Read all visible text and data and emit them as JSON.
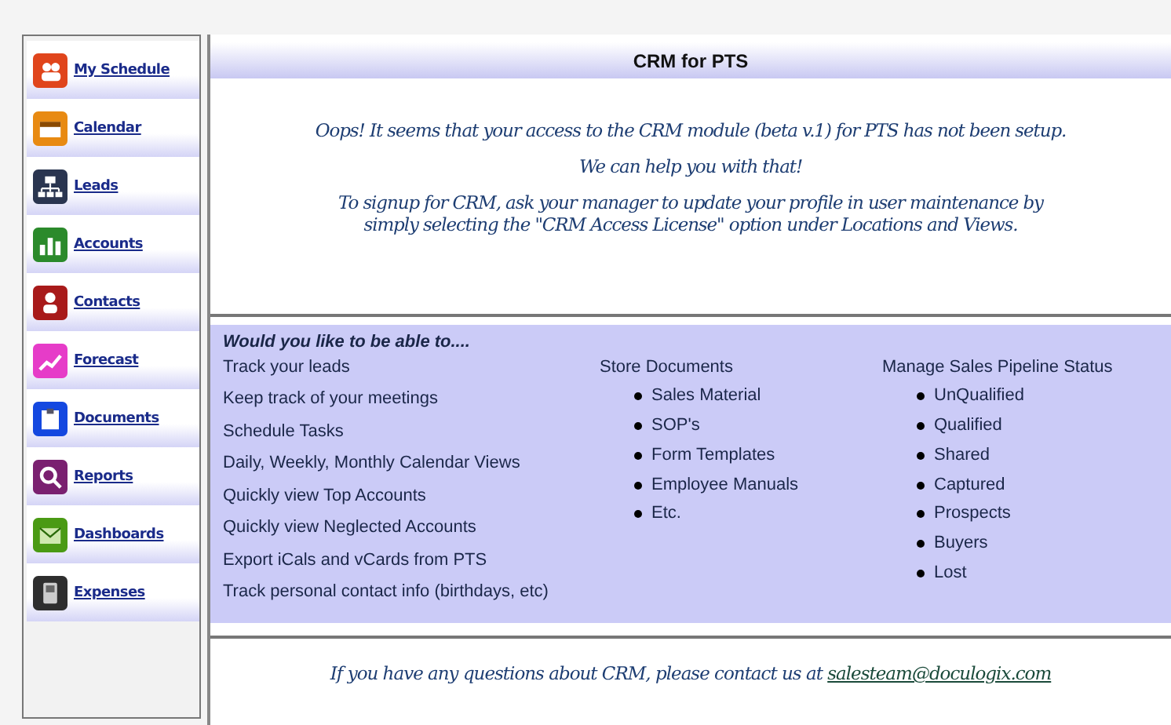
{
  "sidebar": {
    "items": [
      {
        "label": "My Schedule"
      },
      {
        "label": "Calendar"
      },
      {
        "label": "Leads"
      },
      {
        "label": "Accounts"
      },
      {
        "label": "Contacts"
      },
      {
        "label": "Forecast"
      },
      {
        "label": "Documents"
      },
      {
        "label": "Reports"
      },
      {
        "label": "Dashboards"
      },
      {
        "label": "Expenses"
      }
    ]
  },
  "header": {
    "title": "CRM for PTS"
  },
  "message": {
    "lines": [
      "Oops! It seems that your access to the CRM module (beta v.1) for PTS has not been setup.",
      "We can help you with that!",
      "To signup for CRM, ask your manager to update your profile in user maintenance by simply selecting the \"CRM Access License\" option under Locations and Views."
    ]
  },
  "features": {
    "heading": "Would you like to be able to....",
    "column_1": [
      "Track your leads",
      "Keep track of your meetings",
      "Schedule Tasks",
      "Daily, Weekly, Monthly Calendar Views",
      "Quickly view Top Accounts",
      "Quickly view Neglected Accounts",
      "Export iCals and vCards from PTS",
      "Track personal contact info (birthdays, etc)"
    ],
    "column_2": {
      "title": "Store Documents",
      "items": [
        "Sales Material",
        "SOP's",
        "Form Templates",
        "Employee Manuals",
        "Etc."
      ]
    },
    "column_3": {
      "title": "Manage Sales Pipeline Status",
      "items": [
        "UnQualified",
        "Qualified",
        "Shared",
        "Captured",
        "Prospects",
        "Buyers",
        "Lost"
      ]
    }
  },
  "footer": {
    "text": "If you have any questions about CRM, please contact us at",
    "email": "salesteam@doculogix.com"
  }
}
